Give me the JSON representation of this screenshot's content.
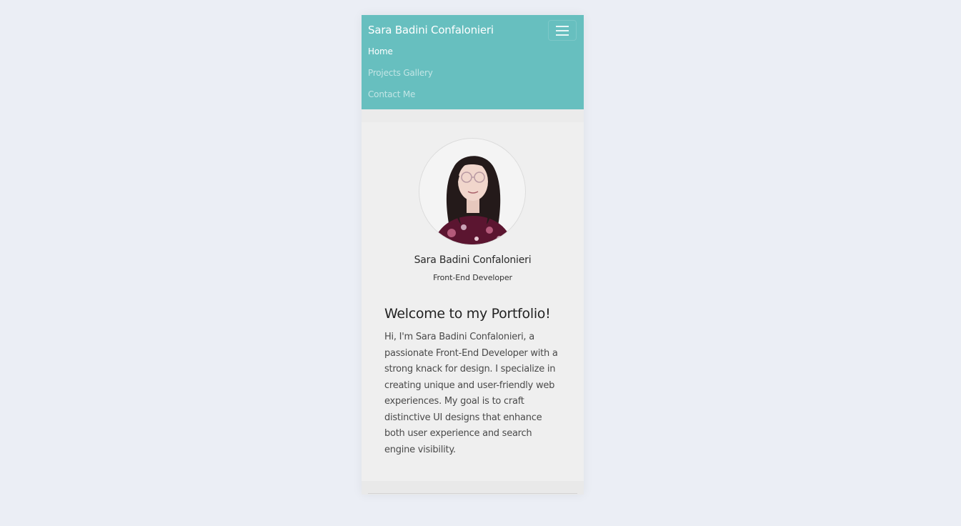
{
  "navbar": {
    "brand": "Sara Badini Confalonieri",
    "toggler_icon": "hamburger-menu-icon",
    "links": [
      {
        "label": "Home",
        "active": true
      },
      {
        "label": "Projects Gallery",
        "active": false
      },
      {
        "label": "Contact Me",
        "active": false
      }
    ]
  },
  "profile": {
    "name": "Sara Badini Confalonieri",
    "role": "Front-End Developer"
  },
  "welcome": {
    "heading": "Welcome to my Portfolio!",
    "lines": [
      "Hi, I'm Sara Badini Confalonieri, a",
      "passionate Front-End Developer with a",
      "strong knack for design. I specialize in",
      "creating unique and user-friendly web",
      "experiences. My goal is to craft",
      "distinctive UI designs that enhance",
      "both user experience and search",
      "engine visibility."
    ]
  },
  "colors": {
    "navbar_bg": "#67bfbf",
    "page_bg": "#ebeef5",
    "content_bg": "#efefef"
  }
}
